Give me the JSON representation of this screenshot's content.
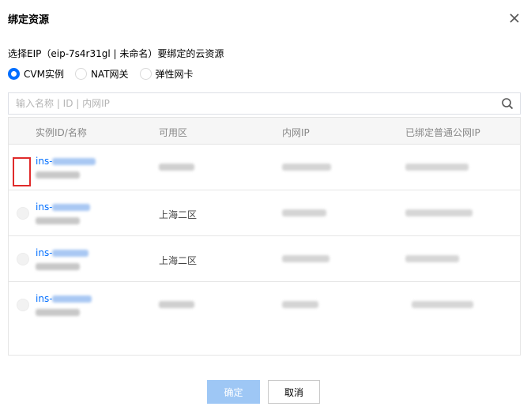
{
  "dialog": {
    "title": "绑定资源",
    "description": "选择EIP（eip-7s4r31gl | 未命名）要绑定的云资源"
  },
  "resource_types": [
    {
      "label": "CVM实例",
      "checked": true
    },
    {
      "label": "NAT网关",
      "checked": false
    },
    {
      "label": "弹性网卡",
      "checked": false
    }
  ],
  "search": {
    "placeholder": "输入名称 | ID | 内网IP",
    "value": ""
  },
  "table": {
    "columns": [
      "实例ID/名称",
      "可用区",
      "内网IP",
      "已绑定普通公网IP"
    ],
    "rows": [
      {
        "id_prefix": "ins-",
        "zone": ""
      },
      {
        "id_prefix": "ins-",
        "zone": "上海二区"
      },
      {
        "id_prefix": "ins-",
        "zone": "上海二区"
      },
      {
        "id_prefix": "ins-",
        "zone": ""
      }
    ]
  },
  "footer": {
    "confirm_label": "确定",
    "cancel_label": "取消"
  },
  "colors": {
    "primary": "#006eff",
    "primary_disabled": "#9ec7f5",
    "highlight_box": "#e02b2b"
  }
}
